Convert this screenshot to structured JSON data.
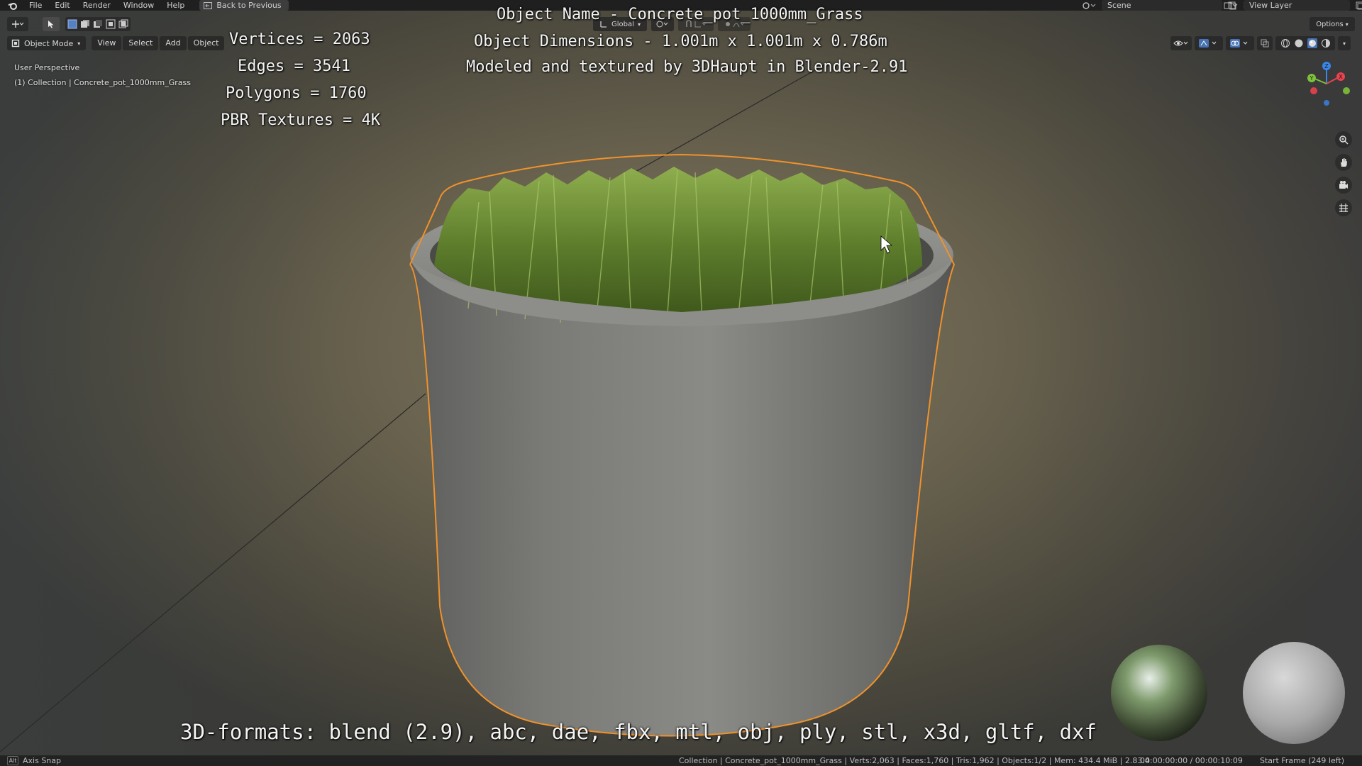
{
  "menu": {
    "items": [
      "File",
      "Edit",
      "Render",
      "Window",
      "Help"
    ],
    "back_button": "Back to Previous",
    "scene_label": "Scene",
    "view_layer_label": "View Layer"
  },
  "header": {
    "transform_orientation": "Global",
    "options_label": "Options",
    "mode": "Object Mode",
    "menus": [
      "View",
      "Select",
      "Add",
      "Object"
    ]
  },
  "viewport": {
    "perspective": "User Perspective",
    "collection": "(1) Collection | Concrete_pot_1000mm_Grass"
  },
  "overlay_text": {
    "object_name": "Object Name - Concrete_pot_1000mm_Grass",
    "dimensions": "Object Dimensions -  1.001m x 1.001m x 0.786m",
    "credits": "Modeled and textured by 3DHaupt in Blender-2.91",
    "vertices": "Vertices = 2063",
    "edges": "Edges = 3541",
    "polygons": "Polygons = 1760",
    "textures": "PBR Textures = 4K",
    "formats": "3D-formats: blend (2.9), abc, dae, fbx, mtl, obj, ply, stl, x3d, gltf, dxf"
  },
  "gizmo": {
    "axes": [
      "Z",
      "X",
      "Y"
    ],
    "colors": {
      "x": "#e8434f",
      "y": "#7ec13a",
      "z": "#3b86e8",
      "selection": "#f0922b"
    }
  },
  "statusbar": {
    "key": "Alt",
    "action": "Axis Snap",
    "stats": "Collection | Concrete_pot_1000mm_Grass | Verts:2,063 | Faces:1,760 | Tris:1,962 | Objects:1/2 | Mem: 434.4 MiB | 2.83.4",
    "time": "00:00:00:00 / 00:00:10:09",
    "frame": "Start Frame (249 left)"
  }
}
